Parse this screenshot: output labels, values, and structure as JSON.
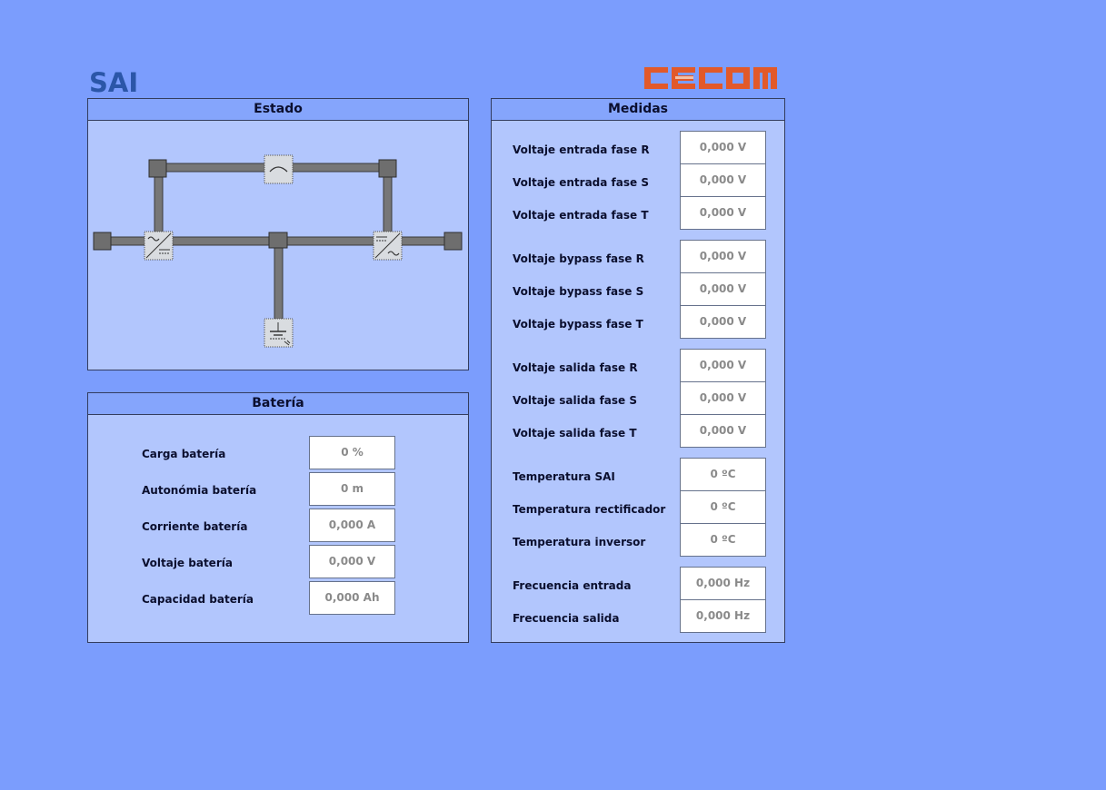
{
  "header": {
    "title": "SAI",
    "logo_text": "CECOM"
  },
  "colors": {
    "background": "#7b9dfd",
    "panel": "#b2c6fd",
    "panel_header": "#85a5fc",
    "logo": "#e2592a",
    "title": "#2b56a8"
  },
  "estado": {
    "title": "Estado",
    "icons": [
      "bypass-switch-icon",
      "rectifier-icon",
      "inverter-icon",
      "battery-icon"
    ]
  },
  "bateria": {
    "title": "Batería",
    "rows": [
      {
        "label": "Carga batería",
        "value": "0 %"
      },
      {
        "label": "Autonómia batería",
        "value": "0 m"
      },
      {
        "label": "Corriente batería",
        "value": "0,000 A"
      },
      {
        "label": "Voltaje batería",
        "value": "0,000 V"
      },
      {
        "label": "Capacidad batería",
        "value": "0,000 Ah"
      }
    ]
  },
  "medidas": {
    "title": "Medidas",
    "rows": [
      {
        "label": "Voltaje entrada fase R",
        "value": "0,000 V"
      },
      {
        "label": "Voltaje entrada fase S",
        "value": "0,000 V"
      },
      {
        "label": "Voltaje entrada fase T",
        "value": "0,000 V"
      },
      {
        "label": "Voltaje bypass fase R",
        "value": "0,000 V"
      },
      {
        "label": "Voltaje bypass fase S",
        "value": "0,000 V"
      },
      {
        "label": "Voltaje bypass fase T",
        "value": "0,000 V"
      },
      {
        "label": "Voltaje salida fase R",
        "value": "0,000 V"
      },
      {
        "label": "Voltaje salida fase S",
        "value": "0,000 V"
      },
      {
        "label": "Voltaje salida fase T",
        "value": "0,000 V"
      },
      {
        "label": "Temperatura SAI",
        "value": "0 ºC"
      },
      {
        "label": "Temperatura rectificador",
        "value": "0 ºC"
      },
      {
        "label": "Temperatura inversor",
        "value": "0 ºC"
      },
      {
        "label": "Frecuencia entrada",
        "value": "0,000 Hz"
      },
      {
        "label": "Frecuencia salida",
        "value": "0,000 Hz"
      }
    ]
  }
}
